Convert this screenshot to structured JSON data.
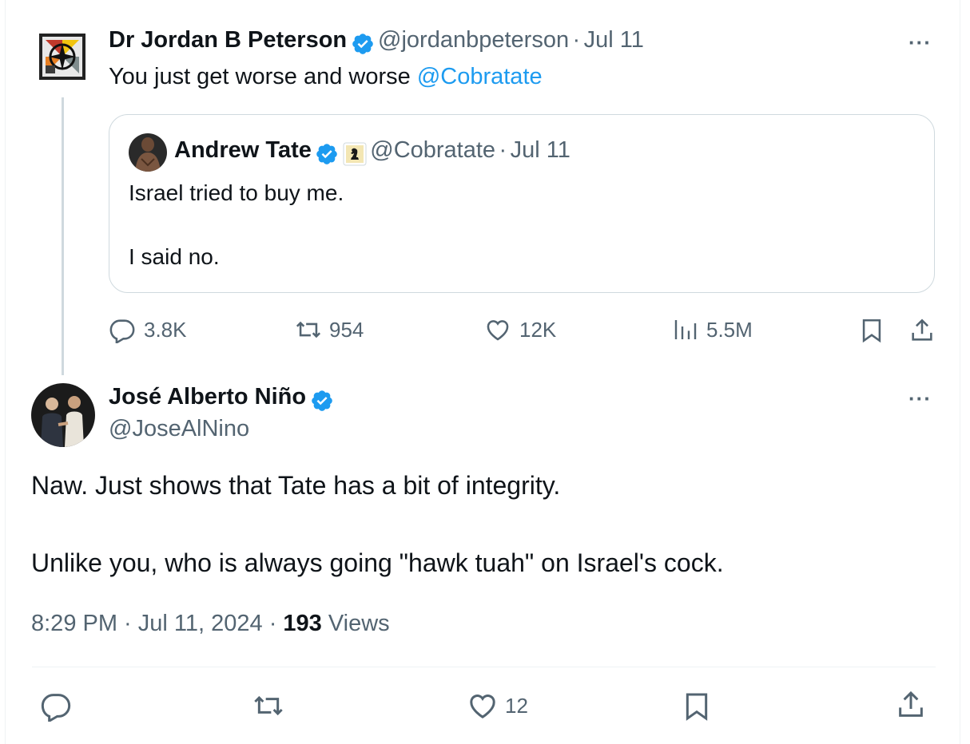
{
  "tweet1": {
    "name": "Dr Jordan B Peterson",
    "handle": "@jordanbpeterson",
    "dot": "·",
    "date": "Jul 11",
    "text_prefix": "You just get worse and worse ",
    "mention": "@Cobratate",
    "more": "···",
    "quote": {
      "name": "Andrew Tate",
      "handle": "@Cobratate",
      "dot": "·",
      "date": "Jul 11",
      "line1": "Israel tried to buy me.",
      "line2": "I said no."
    },
    "actions": {
      "replies": "3.8K",
      "reposts": "954",
      "likes": "12K",
      "views": "5.5M"
    }
  },
  "tweet2": {
    "name": "José Alberto Niño",
    "handle": "@JoseAlNino",
    "more": "···",
    "line1": "Naw. Just shows that Tate has a bit of integrity.",
    "line2": "Unlike you, who is always going \"hawk tuah\" on Israel's cock.",
    "time": "8:29 PM · Jul 11, 2024 · ",
    "views_count": "193",
    "views_label": " Views",
    "actions": {
      "likes": "12"
    }
  },
  "colors": {
    "verified": "#1d9bf0",
    "link": "#1d9bf0",
    "secondary_text": "#536471",
    "border": "#cfd9de"
  }
}
